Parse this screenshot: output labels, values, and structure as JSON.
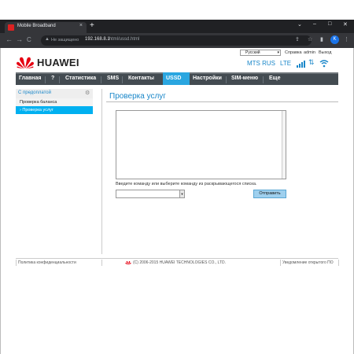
{
  "browser": {
    "tab_title": "Mobile Broadband",
    "close": "×",
    "new_tab": "+",
    "win_controls": [
      "⌄",
      "–",
      "□",
      "✕"
    ],
    "nav": [
      "←",
      "→",
      "C"
    ],
    "security_label": "Не защищено",
    "url_host": "192.168.8.1",
    "url_path": "/html/ussd.html",
    "toolbar_icons": [
      "⇪",
      "☆",
      "▮",
      "⋮"
    ],
    "profile": "K"
  },
  "header": {
    "language": "Русский",
    "links": [
      "Справка",
      "admin",
      "Выход"
    ],
    "logo": "HUAWEI",
    "operator": "MTS RUS",
    "network": "LTE",
    "status_icons": [
      "signal-icon",
      "data-arrows-icon",
      "wifi-icon"
    ]
  },
  "menu": {
    "items": [
      "Главная",
      "?",
      "Статистика",
      "SMS",
      "Контакты",
      "USSD",
      "Настройки",
      "SIM-меню",
      "Еще"
    ],
    "active": "USSD"
  },
  "sidebar": {
    "heading": "С предоплатой",
    "items": [
      {
        "label": "Проверка баланса",
        "active": false
      },
      {
        "label": "› Проверка услуг",
        "active": true
      }
    ]
  },
  "main": {
    "title": "Проверка услуг",
    "hint": "Введите команду или выберите команду из раскрывающегося списка.",
    "command_value": "",
    "send_label": "Отправить"
  },
  "footer": {
    "privacy": "Политика конфиденциальности",
    "copyright": "(C) 2006-2015 HUAWEI TECHNOLOGIES CO., LTD.",
    "oss": "Уведомление открытого ПО"
  },
  "colors": {
    "accent": "#2aa6e0",
    "menu_bg": "#434b51",
    "link": "#1a87c9",
    "sidebar_active": "#00b0f0"
  }
}
